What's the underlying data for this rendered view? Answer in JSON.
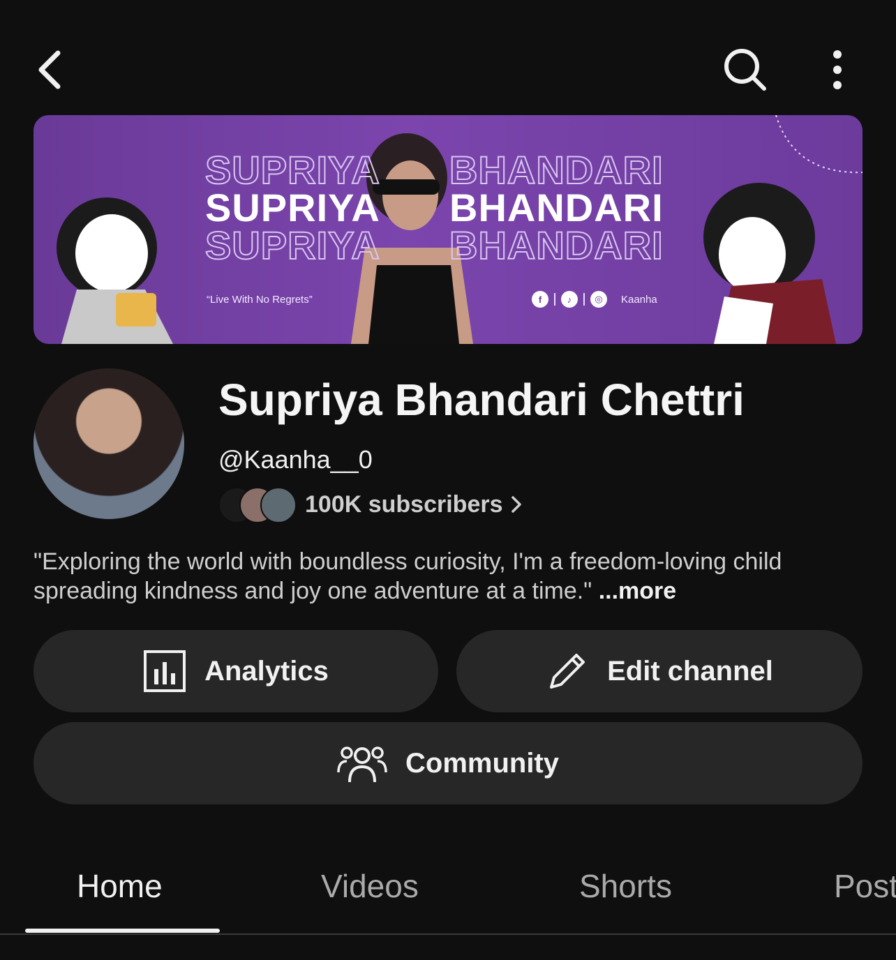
{
  "header": {
    "back_icon": "chevron-left-icon",
    "search_icon": "search-icon",
    "more_icon": "more-vertical-icon"
  },
  "banner": {
    "first_name": "SUPRIYA",
    "last_name": "BHANDARI",
    "quote": "“Live With No Regrets”",
    "social_icons": [
      "facebook-icon",
      "tiktok-icon",
      "instagram-icon"
    ],
    "handle": "Kaanha",
    "background_color": "#6f3fa0"
  },
  "channel": {
    "name": "Supriya Bhandari Chettri",
    "handle": "@Kaanha__0",
    "subscribers": "100K subscribers",
    "description": "\"Exploring the world with boundless curiosity, I'm a freedom-loving child spreading kindness and joy one adventure at a time.\"",
    "more_label": "...more"
  },
  "actions": {
    "analytics_label": "Analytics",
    "edit_label": "Edit channel",
    "community_label": "Community"
  },
  "tabs": [
    {
      "label": "Home",
      "active": true
    },
    {
      "label": "Videos",
      "active": false
    },
    {
      "label": "Shorts",
      "active": false
    },
    {
      "label": "Posts",
      "active": false
    }
  ],
  "colors": {
    "background": "#0f0f0f",
    "button": "#272727",
    "text": "#f1f1f1",
    "muted_text": "#aaaaaa"
  }
}
